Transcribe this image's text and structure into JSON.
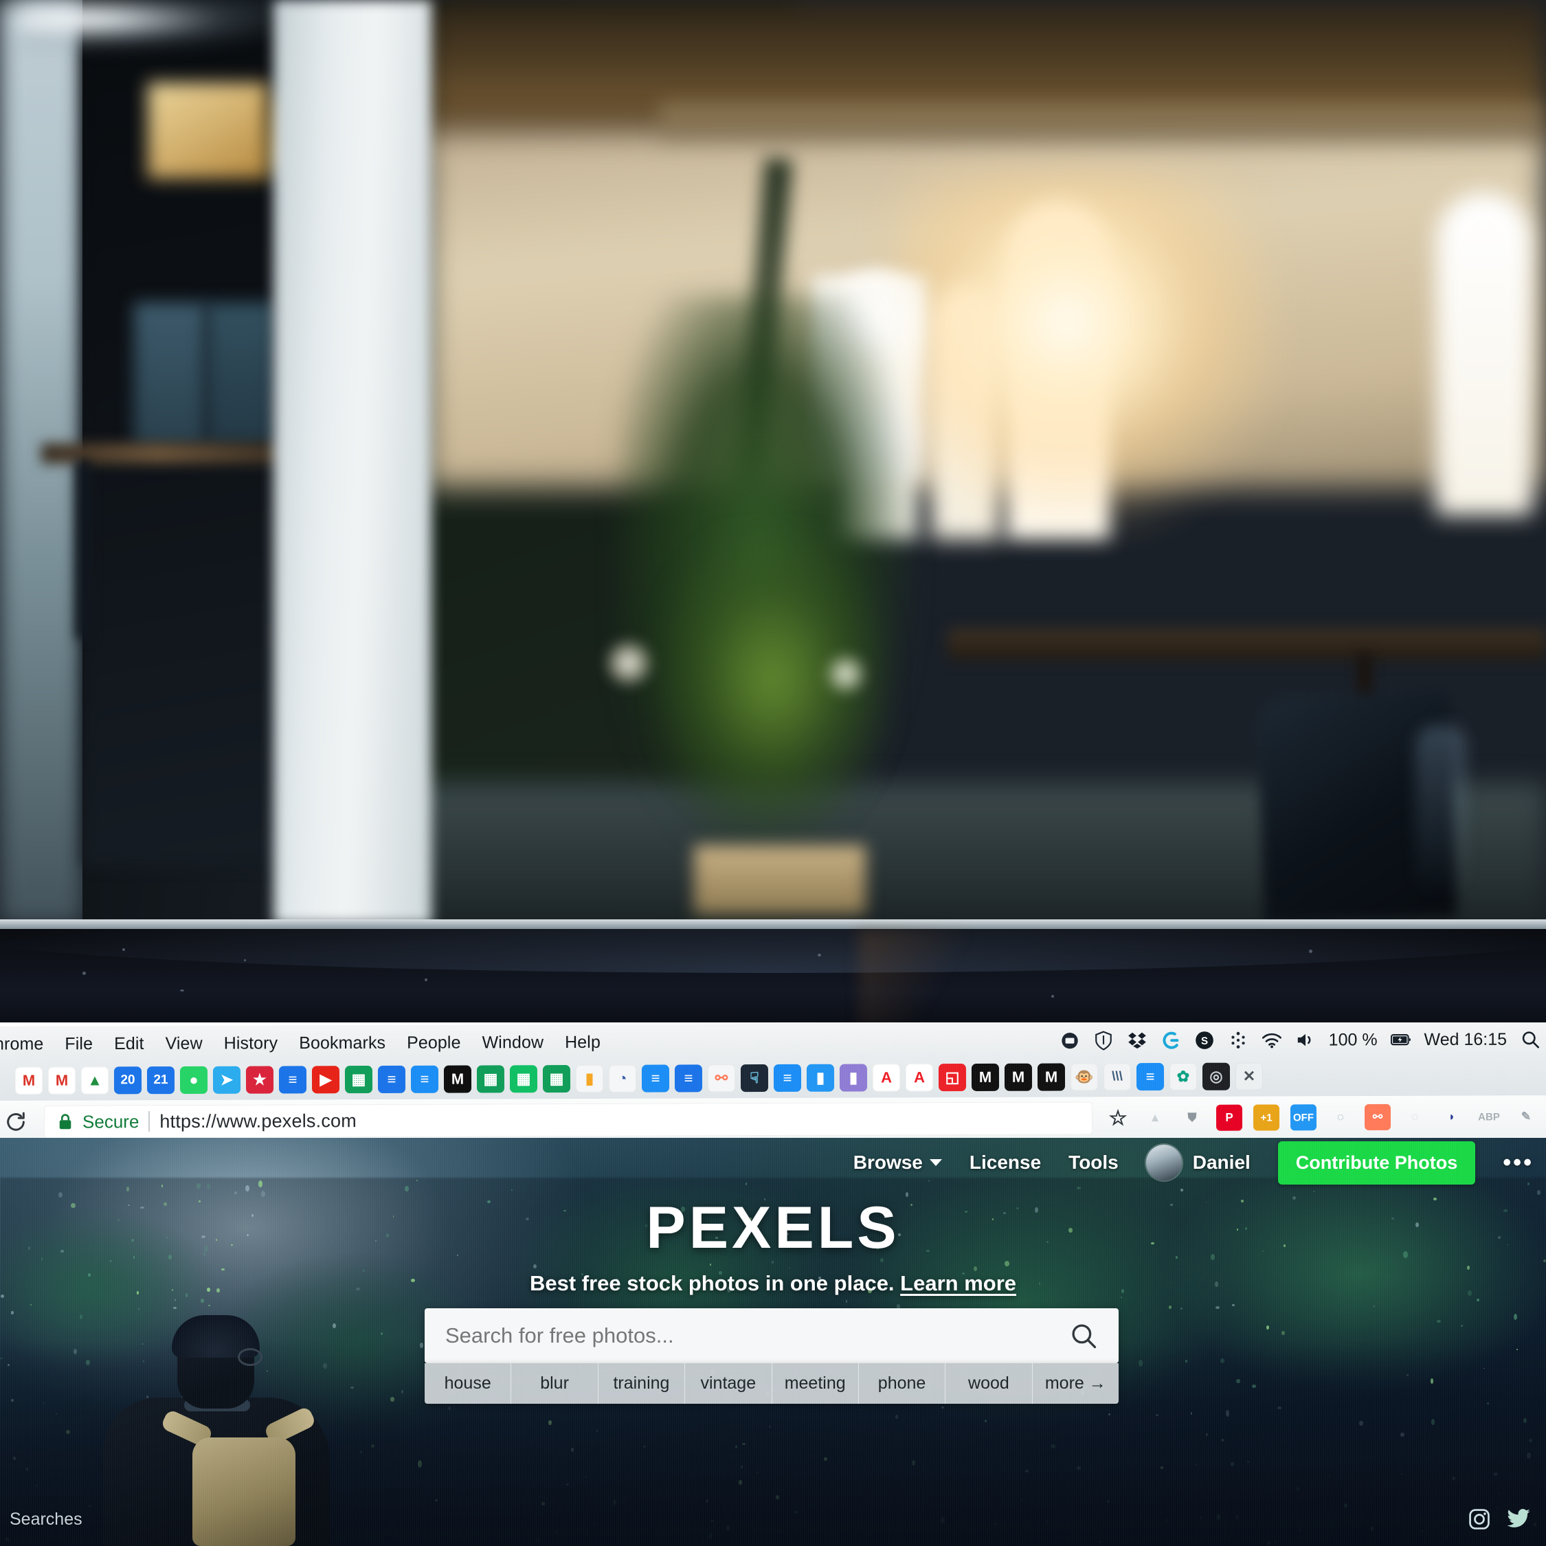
{
  "photo": {
    "description": "blurred office interior with plant, windows and chair",
    "alt": "out-of-focus co-working space background"
  },
  "menubar": {
    "apple_icon": "apple-icon",
    "items": [
      "hrome",
      "File",
      "Edit",
      "View",
      "History",
      "Bookmarks",
      "People",
      "Window",
      "Help"
    ],
    "status_icons": [
      "screen-share-icon",
      "vpn-shield-icon",
      "dropbox-icon",
      "logitech-icon",
      "skype-icon",
      "bluetooth-icon",
      "wifi-icon",
      "volume-icon"
    ],
    "battery_percent": "100 %",
    "battery_icon": "battery-charging-icon",
    "clock": "Wed 16:15",
    "spotlight_icon": "search-icon"
  },
  "bookmarks": {
    "items": [
      {
        "name": "gmail-bookmark",
        "glyph": "M",
        "color": "#ffffff",
        "fg": "#d93025"
      },
      {
        "name": "gmail-alt-bookmark",
        "glyph": "M",
        "color": "#ffffff",
        "fg": "#d93025"
      },
      {
        "name": "google-drive-bookmark",
        "glyph": "▲",
        "color": "#ffffff",
        "fg": "#1e8e3e"
      },
      {
        "name": "calendar-20-bookmark",
        "glyph": "20",
        "color": "#1a73e8",
        "fg": "#ffffff"
      },
      {
        "name": "calendar-21-bookmark",
        "glyph": "21",
        "color": "#1a73e8",
        "fg": "#ffffff"
      },
      {
        "name": "whatsapp-bookmark",
        "glyph": "●",
        "color": "#25d366",
        "fg": "#ffffff"
      },
      {
        "name": "telegram-bookmark",
        "glyph": "➤",
        "color": "#2aabee",
        "fg": "#ffffff"
      },
      {
        "name": "pocket-bookmark",
        "glyph": "★",
        "color": "#d9233b",
        "fg": "#ffffff"
      },
      {
        "name": "google-docs-bookmark",
        "glyph": "≡",
        "color": "#1a73e8",
        "fg": "#ffffff"
      },
      {
        "name": "youtube-bookmark",
        "glyph": "▶",
        "color": "#e62117",
        "fg": "#ffffff"
      },
      {
        "name": "google-sheets-bookmark",
        "glyph": "▦",
        "color": "#0f9d58",
        "fg": "#ffffff"
      },
      {
        "name": "google-docs-2-bookmark",
        "glyph": "≡",
        "color": "#1a73e8",
        "fg": "#ffffff"
      },
      {
        "name": "google-docs-3-bookmark",
        "glyph": "≡",
        "color": "#1a8df5",
        "fg": "#ffffff"
      },
      {
        "name": "medium-bookmark",
        "glyph": "M",
        "color": "#0d0d0d",
        "fg": "#ffffff"
      },
      {
        "name": "google-sheets-2-bookmark",
        "glyph": "▦",
        "color": "#0f9d58",
        "fg": "#ffffff"
      },
      {
        "name": "google-sheets-3-bookmark",
        "glyph": "▦",
        "color": "#0fbf63",
        "fg": "#ffffff"
      },
      {
        "name": "google-sheets-4-bookmark",
        "glyph": "▦",
        "color": "#0f9d58",
        "fg": "#ffffff"
      },
      {
        "name": "google-analytics-bookmark",
        "glyph": "▮",
        "color": "#f5f6f7",
        "fg": "#f5a623"
      },
      {
        "name": "search-console-bookmark",
        "glyph": "◔",
        "color": "#f5f6f7",
        "fg": "#3b5ea8"
      },
      {
        "name": "google-docs-4-bookmark",
        "glyph": "≡",
        "color": "#1a8df5",
        "fg": "#ffffff"
      },
      {
        "name": "google-docs-5-bookmark",
        "glyph": "≡",
        "color": "#1a73e8",
        "fg": "#ffffff"
      },
      {
        "name": "hubspot-bookmark",
        "glyph": "⚯",
        "color": "#f5f6f7",
        "fg": "#ff7a59"
      },
      {
        "name": "cursor-tool-bookmark",
        "glyph": "☟",
        "color": "#1b2735",
        "fg": "#6fc7e8"
      },
      {
        "name": "google-docs-6-bookmark",
        "glyph": "≡",
        "color": "#1a8df5",
        "fg": "#ffffff"
      },
      {
        "name": "chart-blue-bookmark",
        "glyph": "▮",
        "color": "#2196f3",
        "fg": "#ffffff"
      },
      {
        "name": "chart-purple-bookmark",
        "glyph": "▮",
        "color": "#8e7bd4",
        "fg": "#ffffff"
      },
      {
        "name": "adobe-bookmark",
        "glyph": "A",
        "color": "#ffffff",
        "fg": "#ed1c24"
      },
      {
        "name": "adobe-2-bookmark",
        "glyph": "A",
        "color": "#ffffff",
        "fg": "#ed1c24"
      },
      {
        "name": "pdf-bookmark",
        "glyph": "◱",
        "color": "#ec2027",
        "fg": "#ffffff"
      },
      {
        "name": "medium-2-bookmark",
        "glyph": "M",
        "color": "#101010",
        "fg": "#ffffff"
      },
      {
        "name": "medium-3-bookmark",
        "glyph": "M",
        "color": "#101010",
        "fg": "#ffffff"
      },
      {
        "name": "medium-4-bookmark",
        "glyph": "M",
        "color": "#101010",
        "fg": "#ffffff"
      },
      {
        "name": "mailchimp-bookmark",
        "glyph": "🐵",
        "color": "#f2f3f4",
        "fg": "#3b2fb0"
      },
      {
        "name": "steemit-bookmark",
        "glyph": "\\\\\\",
        "color": "#f2f3f4",
        "fg": "#3c5a7a"
      },
      {
        "name": "google-docs-7-bookmark",
        "glyph": "≡",
        "color": "#1a8df5",
        "fg": "#ffffff"
      },
      {
        "name": "pexels-bookmark",
        "glyph": "✿",
        "color": "#f2f3f4",
        "fg": "#05a081"
      },
      {
        "name": "aperture-bookmark",
        "glyph": "◎",
        "color": "#1d1f22",
        "fg": "#c9ced3"
      },
      {
        "name": "close-tab-bookmark",
        "glyph": "✕",
        "color": "#eceff1",
        "fg": "#4a5258"
      }
    ]
  },
  "urlbar": {
    "reload_icon": "reload-icon",
    "lock_icon": "lock-icon",
    "secure_label": "Secure",
    "url": "https://www.pexels.com",
    "extensions": [
      {
        "name": "bookmark-star-icon",
        "glyph": "☆",
        "color": "transparent",
        "fg": "#2b3238"
      },
      {
        "name": "google-drive-extension",
        "glyph": "▲",
        "color": "transparent",
        "fg": "#c9d0d4"
      },
      {
        "name": "shield-extension",
        "glyph": "⛊",
        "color": "transparent",
        "fg": "#8c969c"
      },
      {
        "name": "pinterest-extension",
        "glyph": "P",
        "color": "#e60023",
        "fg": "#ffffff"
      },
      {
        "name": "plus-one-extension",
        "glyph": "+1",
        "color": "#e8a317",
        "fg": "#ffffff"
      },
      {
        "name": "off-toggle-extension",
        "glyph": "OFF",
        "color": "#2196f3",
        "fg": "#ffffff"
      },
      {
        "name": "magnifier-extension",
        "glyph": "◌",
        "color": "transparent",
        "fg": "#8fa3b5"
      },
      {
        "name": "hubspot-extension",
        "glyph": "⚯",
        "color": "#ff7a59",
        "fg": "#ffffff"
      },
      {
        "name": "ghost-extension",
        "glyph": "◌",
        "color": "transparent",
        "fg": "#cdd3d7"
      },
      {
        "name": "honey-extension",
        "glyph": "◗",
        "color": "transparent",
        "fg": "#283593"
      },
      {
        "name": "adblock-plus-extension",
        "glyph": "ABP",
        "color": "transparent",
        "fg": "#a8b0b5"
      },
      {
        "name": "note-edit-extension",
        "glyph": "✎",
        "color": "transparent",
        "fg": "#9aa3a9"
      }
    ]
  },
  "site": {
    "nav": {
      "browse": "Browse",
      "license": "License",
      "tools": "Tools",
      "user": "Daniel",
      "contribute": "Contribute Photos",
      "overflow": "•••"
    },
    "brand": "PEXELS",
    "tagline_text": "Best free stock photos in one place.",
    "tagline_link": "Learn more",
    "search_placeholder": "Search for free photos...",
    "search_value": "",
    "search_icon": "search-icon",
    "tags": [
      "house",
      "blur",
      "training",
      "vintage",
      "meeting",
      "phone",
      "wood",
      "more →"
    ],
    "searches_label": "Searches",
    "social": [
      "instagram-icon",
      "twitter-icon"
    ],
    "accent_green": "#19d845"
  }
}
